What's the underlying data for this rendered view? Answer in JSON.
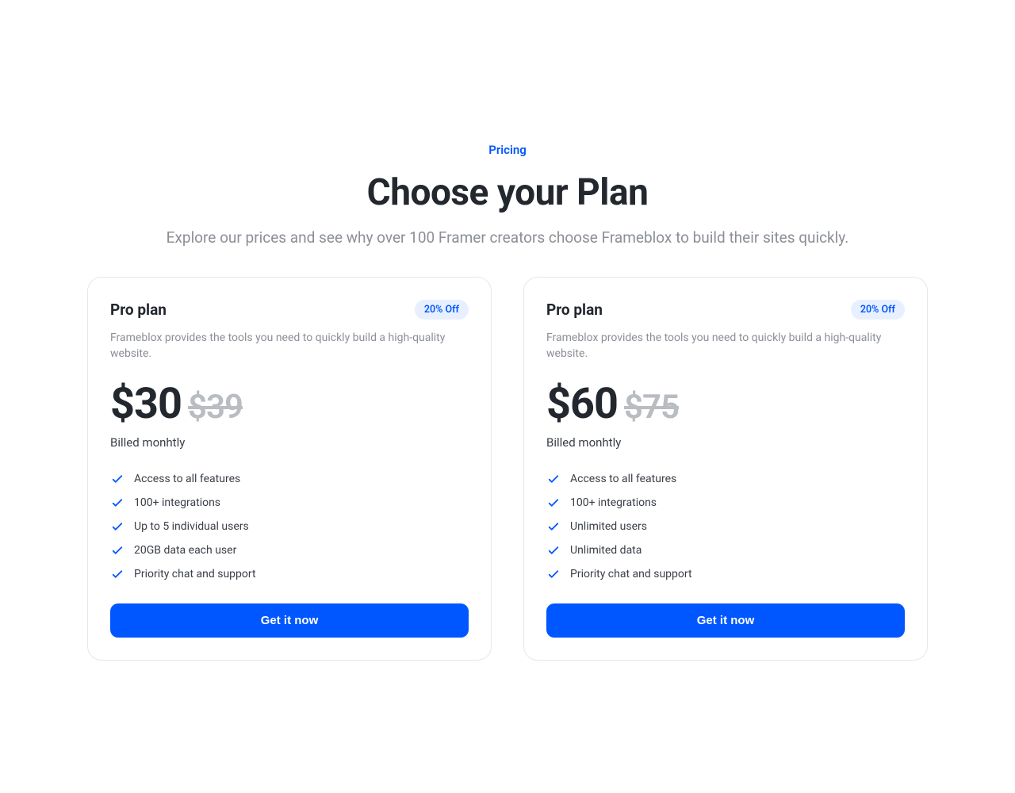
{
  "header": {
    "eyebrow": "Pricing",
    "headline": "Choose your Plan",
    "subhead": "Explore our prices and see why over 100 Framer creators choose Frameblox to build their sites quickly."
  },
  "plans": [
    {
      "name": "Pro plan",
      "badge": "20% Off",
      "desc": "Frameblox provides the tools you need to quickly build a high-quality website.",
      "price": "$30",
      "price_old": "$39",
      "billing": "Billed monhtly",
      "features": [
        "Access to all features",
        "100+ integrations",
        "Up to 5 individual users",
        "20GB data each user",
        "Priority chat and support"
      ],
      "cta": "Get it now"
    },
    {
      "name": "Pro plan",
      "badge": "20% Off",
      "desc": "Frameblox provides the tools you need to quickly build a high-quality website.",
      "price": "$60",
      "price_old": "$75",
      "billing": "Billed monhtly",
      "features": [
        "Access to all features",
        "100+ integrations",
        "Unlimited users",
        "Unlimited data",
        "Priority chat and support"
      ],
      "cta": "Get it now"
    }
  ]
}
